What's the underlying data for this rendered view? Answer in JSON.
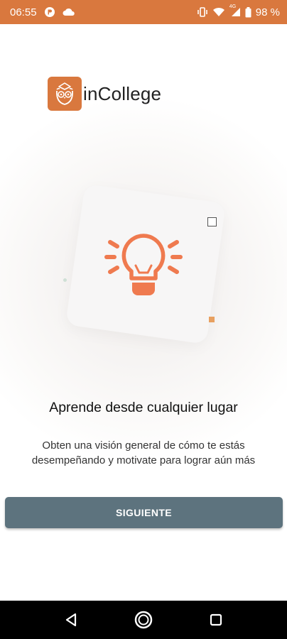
{
  "status_bar": {
    "time": "06:55",
    "battery": "98 %",
    "network_label": "4G",
    "icons": [
      "app-notification-icon",
      "cloud-icon",
      "vibrate-icon",
      "wifi-icon",
      "cellular-signal-icon",
      "battery-icon"
    ]
  },
  "brand": {
    "name": "inCollege",
    "logo_icon": "owl-logo-icon",
    "logo_color": "#d9783e"
  },
  "illustration": {
    "icon": "lightbulb-icon",
    "color": "#ef7a4f"
  },
  "onboarding": {
    "title": "Aprende desde cualquier lugar",
    "description": "Obten una visión general de cómo te estás desempeñando y motivate para lograr aún más"
  },
  "actions": {
    "next_label": "SIGUIENTE",
    "next_color": "#5d737e"
  },
  "nav_bar": {
    "icons": [
      "back-icon",
      "home-icon",
      "recents-icon"
    ]
  }
}
